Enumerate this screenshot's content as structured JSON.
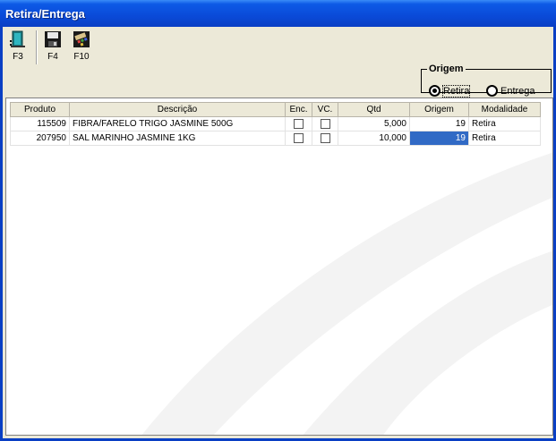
{
  "window": {
    "title": "Retira/Entrega"
  },
  "toolbar": [
    {
      "key": "F3",
      "icon": "exit-door-icon"
    },
    {
      "key": "F4",
      "icon": "floppy-disk-save-icon"
    },
    {
      "key": "F10",
      "icon": "calculator-icon"
    }
  ],
  "origem": {
    "legend": "Origem",
    "options": [
      {
        "label": "Retira",
        "selected": true
      },
      {
        "label": "Entrega",
        "selected": false
      }
    ]
  },
  "grid": {
    "columns": [
      "Produto",
      "Descrição",
      "Enc.",
      "VC.",
      "Qtd",
      "Origem",
      "Modalidade"
    ],
    "rows": [
      {
        "produto": "115509",
        "descricao": "FIBRA/FARELO TRIGO JASMINE 500G",
        "enc": false,
        "vc": false,
        "qtd": "5,000",
        "origem": "19",
        "modalidade": "Retira"
      },
      {
        "produto": "207950",
        "descricao": "SAL MARINHO JASMINE 1KG",
        "enc": false,
        "vc": false,
        "qtd": "10,000",
        "origem": "19",
        "modalidade": "Retira"
      }
    ]
  },
  "colors": {
    "title_bar": "#0a4ad8",
    "selection": "#316ac5",
    "window_bg": "#ece9d8"
  }
}
